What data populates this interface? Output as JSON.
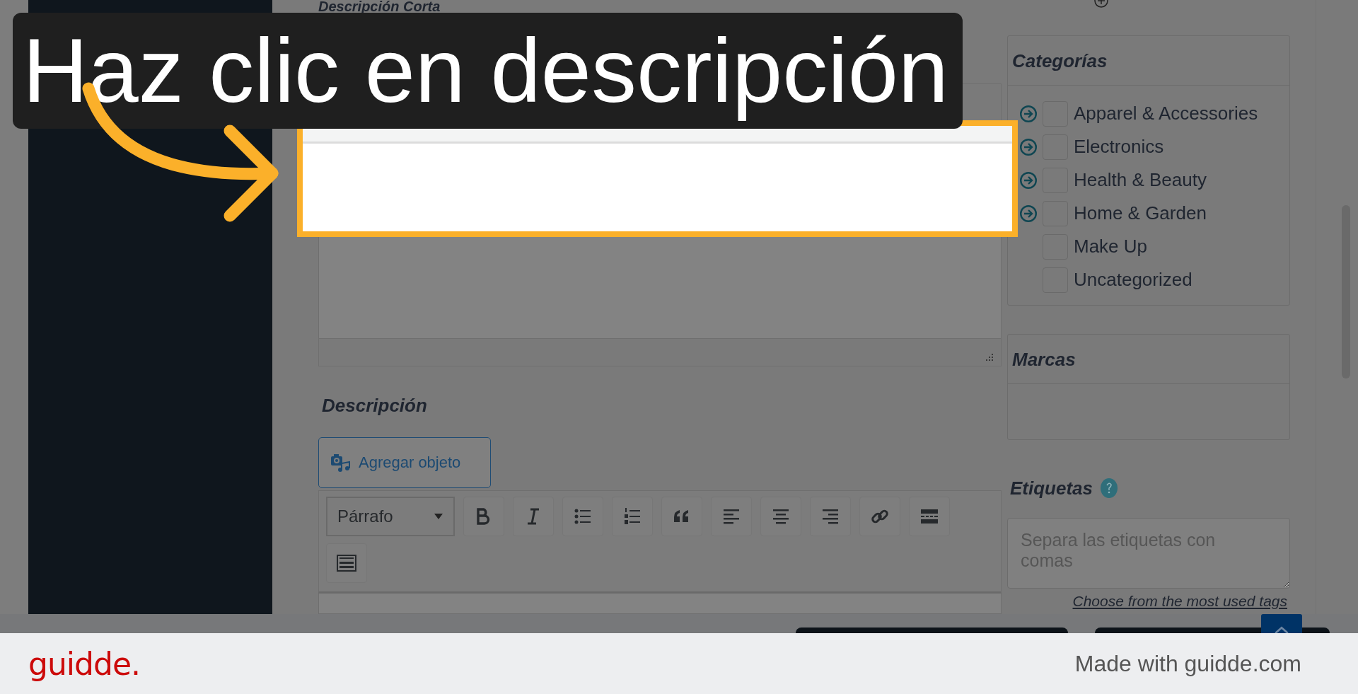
{
  "short_description": {
    "title": "Descripción Corta"
  },
  "description": {
    "title": "Descripción",
    "add_media_button": "Agregar objeto",
    "format_select": "Párrafo",
    "toolbar": [
      {
        "kind": "bold"
      },
      {
        "kind": "italic"
      },
      {
        "kind": "bullets"
      },
      {
        "kind": "numbers"
      },
      {
        "kind": "quote"
      },
      {
        "kind": "align-left"
      },
      {
        "kind": "align-center"
      },
      {
        "kind": "align-right"
      },
      {
        "kind": "link"
      },
      {
        "kind": "more"
      },
      {
        "kind": "keyboard"
      }
    ]
  },
  "categories": {
    "title": "Categorías",
    "items": [
      {
        "label": "Apparel & Accessories",
        "checked": false,
        "has_children": true
      },
      {
        "label": "Electronics",
        "checked": false,
        "has_children": true
      },
      {
        "label": "Health & Beauty",
        "checked": false,
        "has_children": true
      },
      {
        "label": "Home & Garden",
        "checked": false,
        "has_children": true
      },
      {
        "label": "Make Up",
        "checked": false,
        "has_children": false
      },
      {
        "label": "Uncategorized",
        "checked": false,
        "has_children": false
      }
    ]
  },
  "brands": {
    "title": "Marcas"
  },
  "tags": {
    "title": "Etiquetas",
    "placeholder": "Separa las etiquetas con comas",
    "link": "Choose from the most used tags"
  },
  "callout": {
    "text": "Haz clic en descripción"
  },
  "footer": {
    "logo": "guidde.",
    "credit": "Made with guidde.com"
  }
}
